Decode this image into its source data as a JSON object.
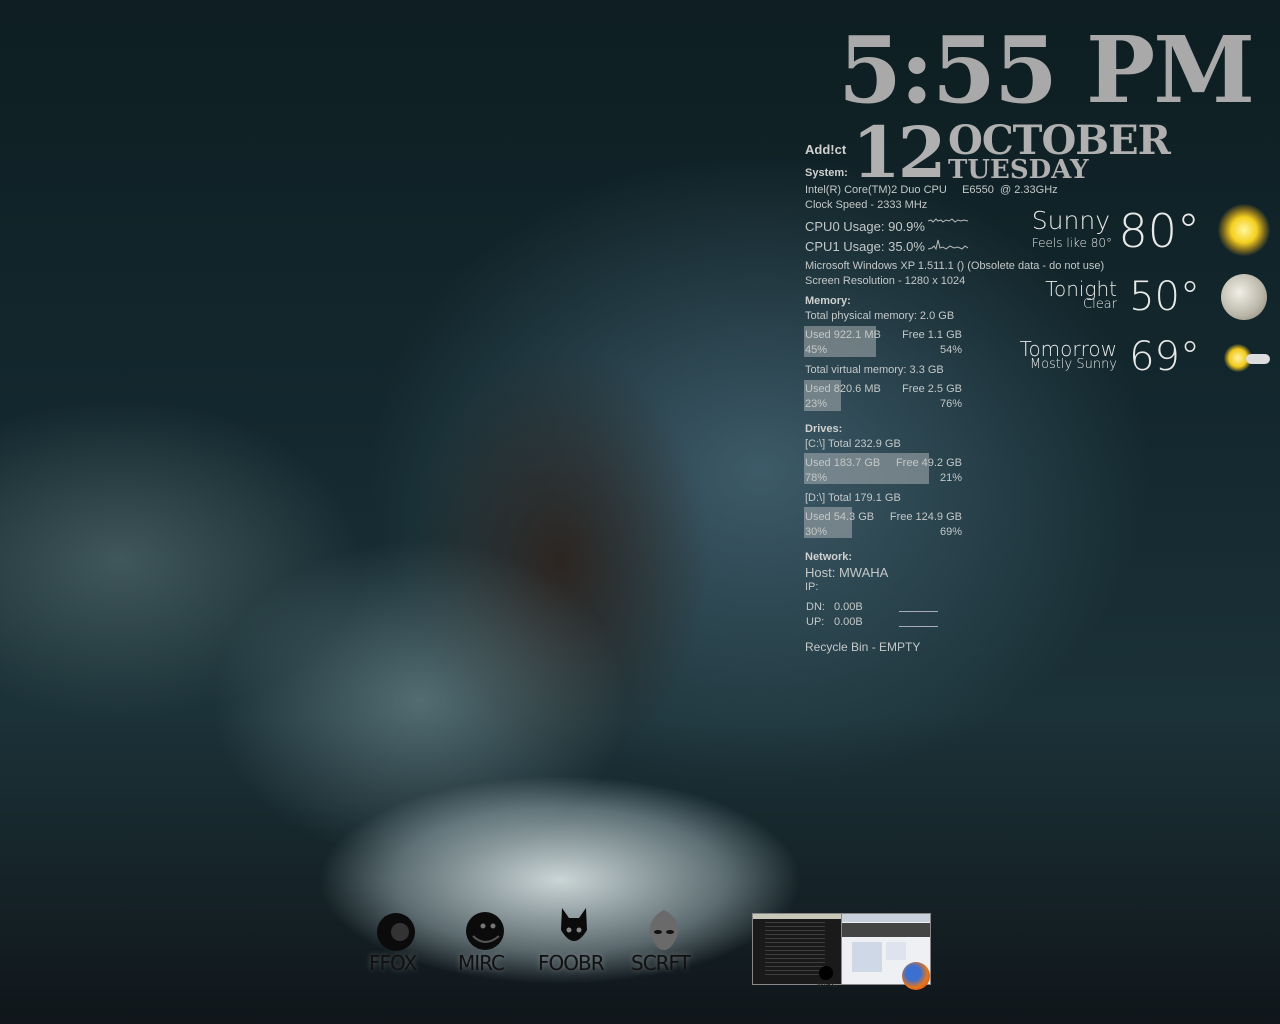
{
  "clock": {
    "time": "5:55 PM",
    "day": "12",
    "month": "OCTOBER",
    "weekday": "TUESDAY"
  },
  "system": {
    "brand": "Add!ct",
    "heading": "System:",
    "cpu": "Intel(R) Core(TM)2 Duo CPU     E6550  @ 2.33GHz",
    "clock_speed": "Clock Speed - 2333 MHz",
    "cpu0": "CPU0 Usage: 90.9%",
    "cpu1": "CPU1 Usage: 35.0%",
    "os": "Microsoft Windows XP 1.511.1 () (Obsolete data - do not use)",
    "resolution": "Screen Resolution - 1280 x 1024"
  },
  "memory": {
    "heading": "Memory:",
    "physical": {
      "total": "Total physical memory: 2.0 GB",
      "used": "Used 922.1 MB",
      "free": "Free 1.1 GB",
      "used_pct": "45%",
      "free_pct": "54%",
      "fill": 45
    },
    "virtual": {
      "total": "Total virtual memory: 3.3 GB",
      "used": "Used 820.6 MB",
      "free": "Free 2.5 GB",
      "used_pct": "23%",
      "free_pct": "76%",
      "fill": 23
    }
  },
  "drives": {
    "heading": "Drives:",
    "c": {
      "total": "[C:\\] Total 232.9 GB",
      "used": "Used 183.7 GB",
      "free": "Free 49.2 GB",
      "used_pct": "78%",
      "free_pct": "21%",
      "fill": 78
    },
    "d": {
      "total": "[D:\\] Total 179.1 GB",
      "used": "Used 54.3 GB",
      "free": "Free 124.9 GB",
      "used_pct": "30%",
      "free_pct": "69%",
      "fill": 30
    }
  },
  "network": {
    "heading": "Network:",
    "host": "Host: MWAHA",
    "ip": "IP:",
    "dn_label": "DN:",
    "dn": "0.00B",
    "up_label": "UP:",
    "up": "0.00B"
  },
  "recycle": "Recycle Bin - EMPTY",
  "weather": {
    "now": {
      "cond": "Sunny",
      "feels": "Feels like 80°",
      "temp": "80°",
      "icon": "sun-icon"
    },
    "tonight": {
      "label": "Tonight",
      "cond": "Clear",
      "temp": "50°",
      "icon": "moon-icon"
    },
    "tomorrow": {
      "label": "Tomorrow",
      "cond": "Mostly Sunny",
      "temp": "69°",
      "icon": "partly-sunny-icon"
    }
  },
  "launcher": [
    {
      "label": "FFOX",
      "icon": "firefox-icon"
    },
    {
      "label": "MIRC",
      "icon": "mirc-icon"
    },
    {
      "label": "FOOBR",
      "icon": "foobar-icon"
    },
    {
      "label": "SCRFT",
      "icon": "scrft-icon"
    }
  ],
  "taskbar": {
    "thumb1_label": "MIRC"
  }
}
